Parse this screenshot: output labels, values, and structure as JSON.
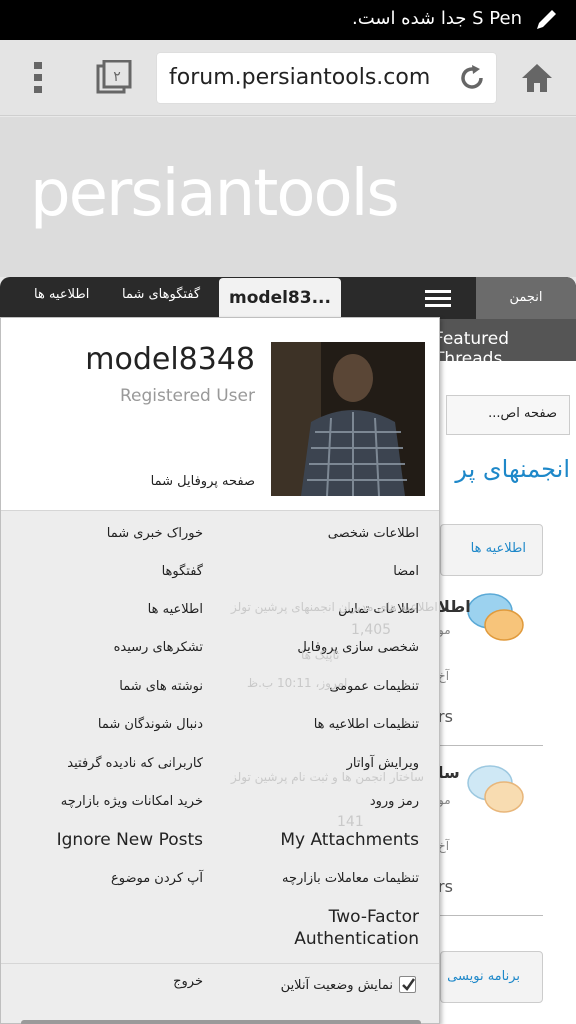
{
  "status_bar": {
    "message": "S Pen جدا شده است."
  },
  "browser": {
    "url": "forum.persiantools.com",
    "tabs_count": "۲"
  },
  "site": {
    "logo": "persiantools"
  },
  "navbar": {
    "tab_notifications": "اطلاعیه ها",
    "tab_conversations": "گفتگوهای شما",
    "tab_user": "model83...",
    "tab_forums": "انجمن"
  },
  "background": {
    "featured": "Featured Threads",
    "breadcrumb": "صفحه اص...",
    "forums_title": "انجمنهای پر",
    "announcements_box": "اطلاعیه ها",
    "programming_box": "برنامه نویسی",
    "frag_1": "اطلا",
    "frag_2": "سا",
    "frag_3": "آخ",
    "frag_4": "آخ",
    "frag_5": "rs",
    "frag_6": "rs",
    "frag_7": "مو",
    "frag_8": "مو",
    "ghost_1": "اطلاعیه های مدیران انجمنهای پرشین تولز",
    "ghost_2": "1,405",
    "ghost_3": "تاپیک ها",
    "ghost_4": "امروز، 10:11 ب.ظ",
    "ghost_5": "ساختار انجمن ها و ثبت نام پرشین تولز",
    "ghost_6": "141"
  },
  "profile": {
    "username": "model8348",
    "usertitle": "Registered User",
    "profile_link": "صفحه پروفایل شما"
  },
  "menu": {
    "right_column": [
      "اطلاعات شخصی",
      "امضا",
      "اطلاعات تماس",
      "شخصی سازی پروفایل",
      "تنظیمات عمومی",
      "تنظیمات اطلاعیه ها",
      "ویرایش آواتار",
      "رمز ورود",
      "My Attachments",
      "تنظیمات معاملات بازارچه",
      "Two-Factor Authentication"
    ],
    "left_column": [
      "خوراک خبری شما",
      "گفتگوها",
      "اطلاعیه ها",
      "تشکرهای رسیده",
      "نوشته های شما",
      "دنبال شوندگان شما",
      "کاربرانی که نادیده گرفتید",
      "خرید امکانات ویژه بازارچه",
      "Ignore New Posts",
      "آپ کردن موضوع"
    ]
  },
  "footer": {
    "show_online": "نمایش وضعیت آنلاین",
    "show_online_checked": true,
    "logout": "خروج"
  },
  "colors": {
    "link_blue": "#1e88c9",
    "nav_dark": "#2a2a2a"
  }
}
